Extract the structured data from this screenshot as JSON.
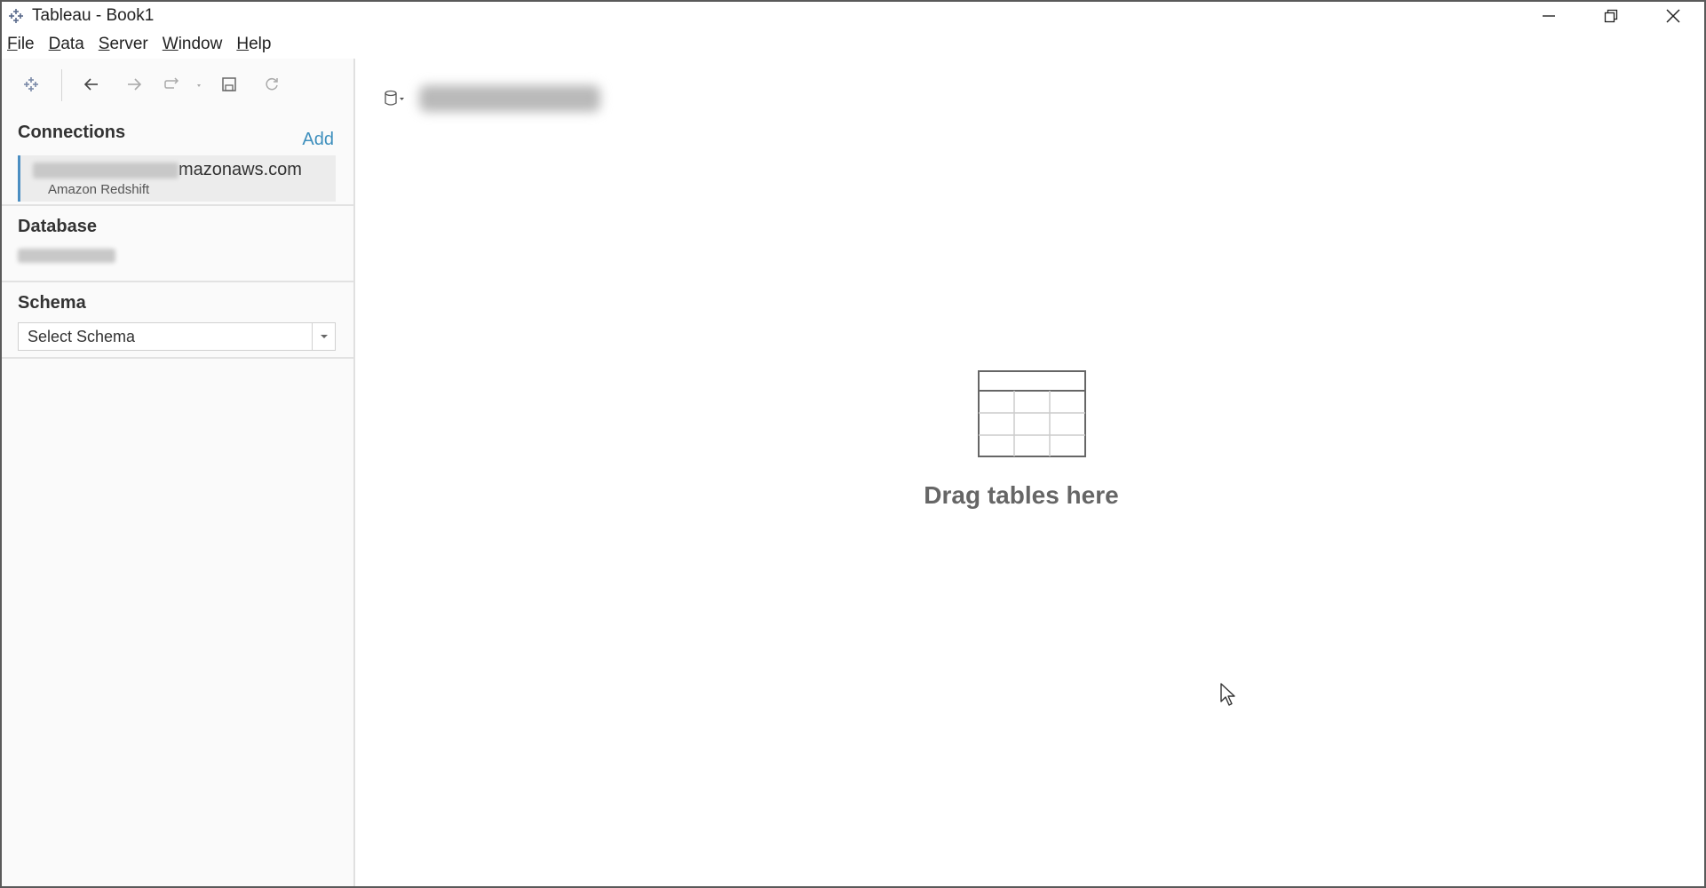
{
  "window": {
    "title": "Tableau - Book1"
  },
  "menu": {
    "file": {
      "first": "F",
      "rest": "ile"
    },
    "data": {
      "first": "D",
      "rest": "ata"
    },
    "server": {
      "first": "S",
      "rest": "erver"
    },
    "window": {
      "first": "W",
      "rest": "indow"
    },
    "help": {
      "first": "H",
      "rest": "elp"
    }
  },
  "toolbar": {
    "icons": [
      "tableau-logo-icon",
      "back-arrow-icon",
      "forward-arrow-icon",
      "redo-icon",
      "save-icon",
      "refresh-icon"
    ]
  },
  "connections": {
    "title": "Connections",
    "add_label": "Add",
    "item": {
      "host_suffix": "mazonaws.com",
      "type": "Amazon Redshift"
    }
  },
  "database": {
    "title": "Database"
  },
  "schema": {
    "title": "Schema",
    "selected": "Select Schema"
  },
  "canvas": {
    "empty_message": "Drag tables here"
  },
  "colors": {
    "accent": "#3e8fbd",
    "connection_border": "#4b8ec2"
  }
}
